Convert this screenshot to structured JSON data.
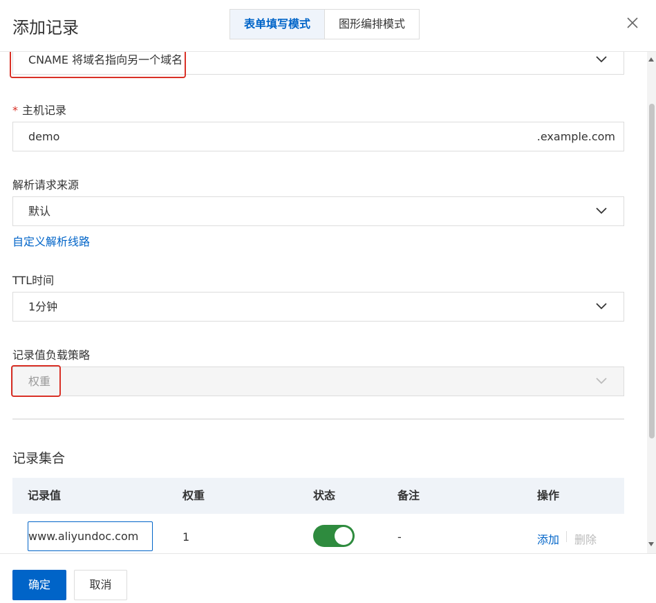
{
  "dialog": {
    "title": "添加记录",
    "modes": [
      "表单填写模式",
      "图形编排模式"
    ],
    "active_mode": "表单填写模式"
  },
  "form": {
    "record_type": {
      "value": "CNAME 将域名指向另一个域名"
    },
    "host_record": {
      "label": "主机记录",
      "required_mark": "*",
      "value": "demo",
      "suffix": ".example.com"
    },
    "resolution_source": {
      "label": "解析请求来源",
      "value": "默认",
      "link": "自定义解析线路"
    },
    "ttl": {
      "label": "TTL时间",
      "value": "1分钟"
    },
    "load_strategy": {
      "label": "记录值负载策略",
      "value": "权重",
      "disabled": true
    }
  },
  "record_set": {
    "title": "记录集合",
    "columns": [
      "记录值",
      "权重",
      "状态",
      "备注",
      "操作"
    ],
    "rows": [
      {
        "value": "www.aliyundoc.com",
        "weight": "1",
        "status_on": true,
        "remark": "-",
        "actions": [
          "添加",
          "删除"
        ]
      }
    ]
  },
  "footer": {
    "ok_label": "确定",
    "cancel_label": "取消"
  },
  "colors": {
    "primary": "#0064c8",
    "highlight": "#d93026",
    "switch_on": "#2e8b3e"
  }
}
